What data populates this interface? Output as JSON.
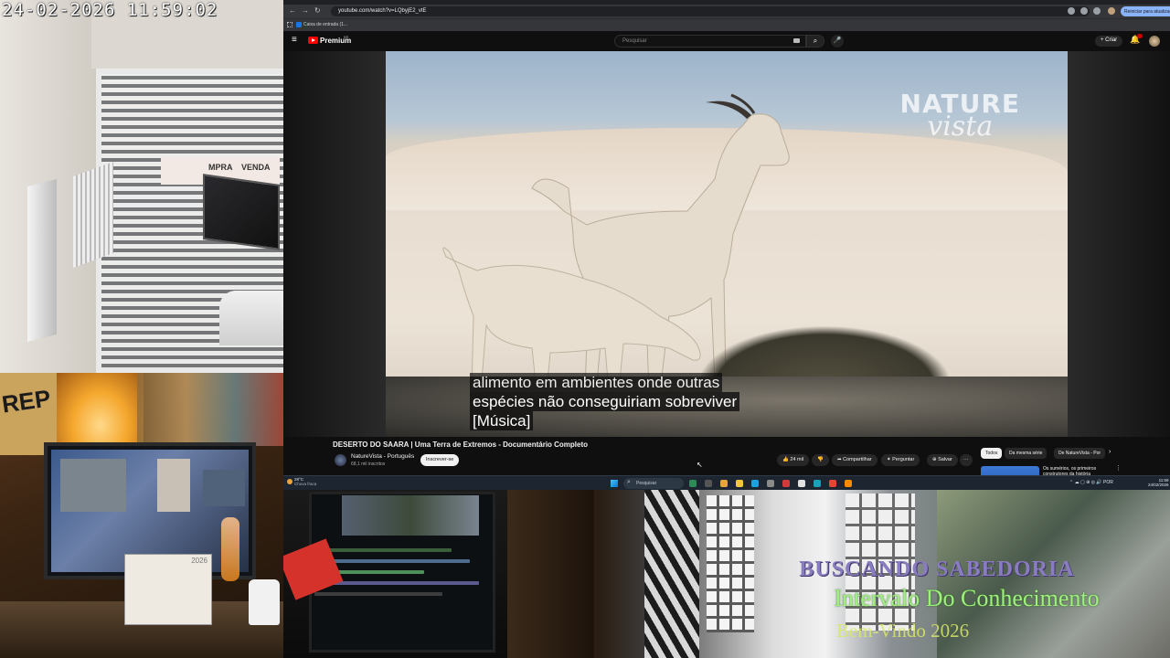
{
  "overlay": {
    "camera_timestamp": "24-02-2026  11:59:02",
    "desk_graffiti": "REP",
    "calendar_year": "2026",
    "shop_sign_left": "MPRA",
    "shop_sign_right": "VENDA",
    "banner_line1": "BUSCANDO SABEDORIA",
    "banner_line2": "Intervalo Do Conhecimento",
    "banner_line3": "Bem-Vindo 2026"
  },
  "browser": {
    "url": "youtube.com/watch?v=LQbyjE2_vtE",
    "update_button": "Reiniciar para atualizar",
    "bookmark": "Caixa de entrada (1...",
    "nav_back": "←",
    "nav_forward": "→",
    "nav_reload": "↻"
  },
  "youtube": {
    "menu_icon": "≡",
    "brand": "Premium",
    "brand_sup": "BR",
    "search_placeholder": "Pesquisar",
    "search_icon": "⌕",
    "mic_icon": "🎤",
    "create_label": "+ Criar",
    "bell_icon": "🔔",
    "logo_line1": "NATURE",
    "logo_line2": "vista",
    "subtitle_line0": "alimento em ambientes onde outras",
    "subtitle_line1": "espécies não conseguiriam sobreviver",
    "subtitle_line2": "[Música]",
    "video_title": "DESERTO DO SAARA | Uma Terra de Extremos - Documentário Completo",
    "channel_name": "NatureVista - Português",
    "channel_subs": "68,1 mil inscritos",
    "subscribe_label": "Inscrever-se",
    "like_label": "👍 24 mil",
    "dislike_label": "👎",
    "share_label": "➦ Compartilhar",
    "thanks_label": "✦ Perguntar",
    "save_label": "⊕ Salvar",
    "more_label": "···",
    "chips": [
      "Todos",
      "Da mesma série",
      "De NatureVista - Por"
    ],
    "chip_next": "›",
    "rec_title": "Os sumérios, os primeiros construtores da história",
    "rec_more": "⋮",
    "cursor": "↖"
  },
  "taskbar": {
    "temp": "28°C",
    "condition": "Chuva fraca",
    "search": "Pesquisar",
    "tray": "⌃  ☁  ▢  ⊕  ◎  🔊  POR",
    "time": "11:59",
    "date": "24/02/2026"
  },
  "colors": {
    "youtube_red": "#ff0000",
    "banner_purple": "#8a7cc0",
    "banner_green": "#9ff07d",
    "banner_yellow": "#d9e86a"
  }
}
